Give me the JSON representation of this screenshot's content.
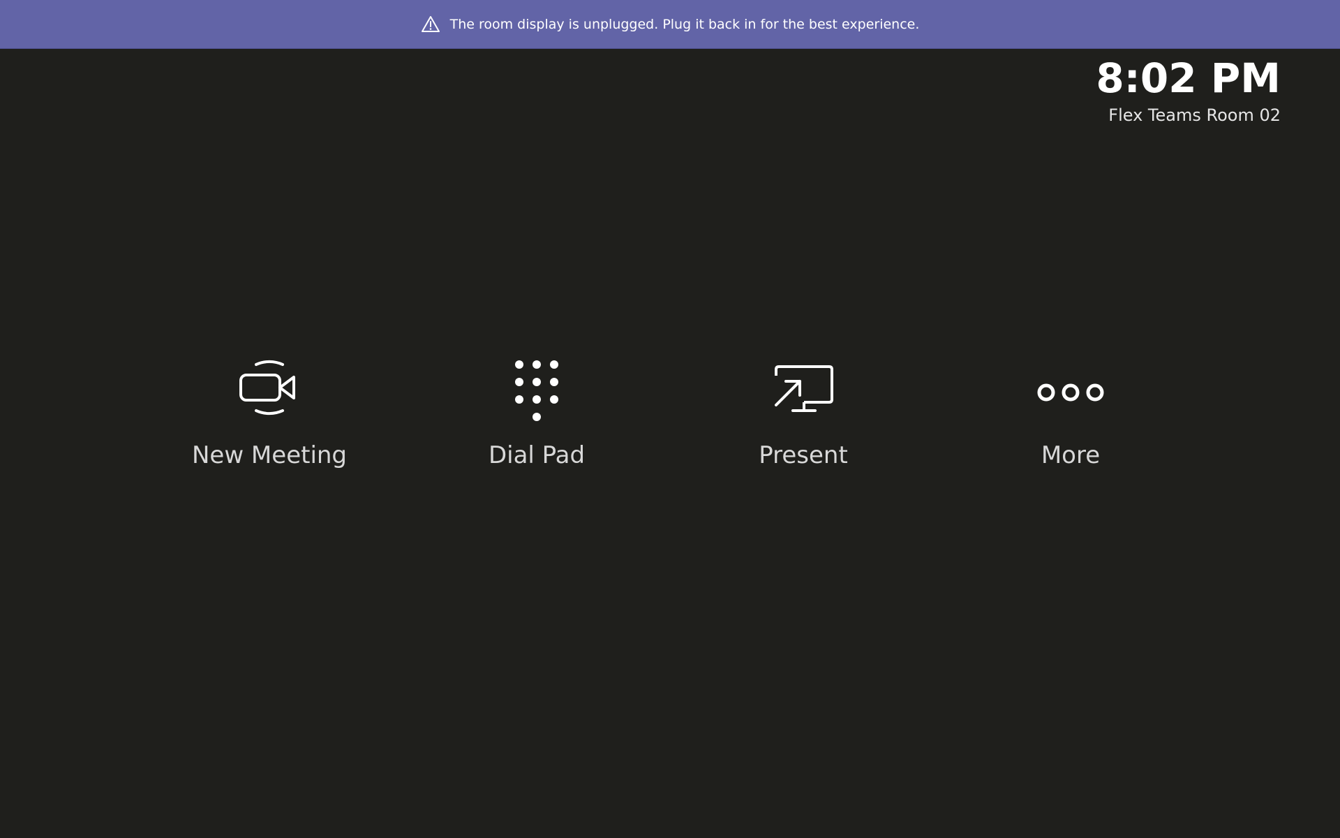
{
  "banner": {
    "message": "The room display is unplugged. Plug it back in for the best experience.",
    "icon": "warning-icon",
    "background": "#6264a7"
  },
  "clock": {
    "time": "8:02 PM",
    "room_name": "Flex Teams Room 02"
  },
  "actions": [
    {
      "label": "New Meeting",
      "icon": "video-camera-icon"
    },
    {
      "label": "Dial Pad",
      "icon": "dial-pad-icon"
    },
    {
      "label": "Present",
      "icon": "present-screen-icon"
    },
    {
      "label": "More",
      "icon": "more-icon"
    }
  ],
  "colors": {
    "background": "#1f1f1c",
    "accent": "#6264a7",
    "text": "#ffffff",
    "label_text": "#d8d8d8"
  }
}
